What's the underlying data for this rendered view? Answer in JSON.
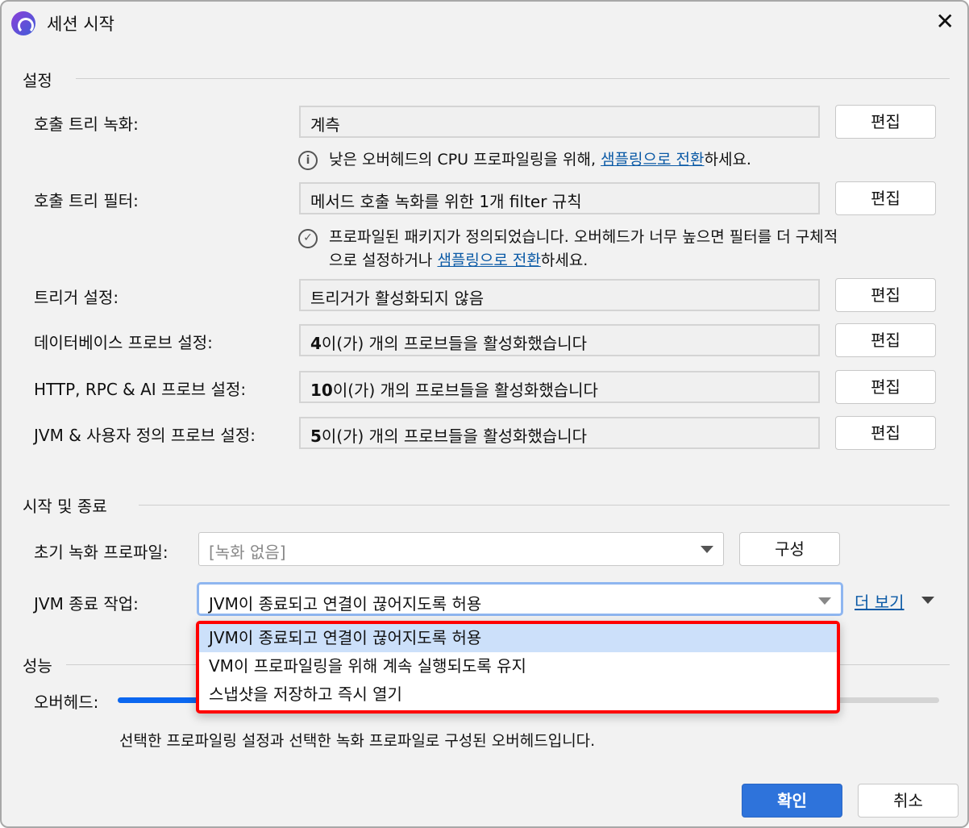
{
  "window": {
    "title": "세션 시작"
  },
  "sections": {
    "settings": "설정",
    "startstop": "시작 및 종료",
    "performance": "성능"
  },
  "rows": [
    {
      "label": "호출 트리 녹화:",
      "bold": "",
      "value": "계측",
      "button": "편집"
    },
    {
      "label": "호출 트리 필터:",
      "bold": "",
      "value": "메서드 호출 녹화를 위한 1개 filter 규칙",
      "button": "편집"
    },
    {
      "label": "트리거 설정:",
      "bold": "",
      "value": "트리거가 활성화되지 않음",
      "button": "편집"
    },
    {
      "label": "데이터베이스 프로브 설정:",
      "bold": "4",
      "value": "이(가) 개의 프로브들을 활성화했습니다",
      "button": "편집"
    },
    {
      "label": "HTTP, RPC & AI 프로브 설정:",
      "bold": "10",
      "value": "이(가) 개의 프로브들을 활성화했습니다",
      "button": "편집"
    },
    {
      "label": "JVM & 사용자 정의 프로브 설정:",
      "bold": "5",
      "value": "이(가) 개의 프로브들을 활성화했습니다",
      "button": "편집"
    }
  ],
  "notes": {
    "info_prefix": "낮은 오버헤드의 CPU 프로파일링을 위해, ",
    "info_link": "샘플링으로 전환",
    "info_suffix": "하세요.",
    "check_line1": "프로파일된 패키지가 정의되었습니다. 오버헤드가 너무 높으면 필터를 더 구체적",
    "check_prefix": "으로 설정하거나 ",
    "check_link": "샘플링으로 전환",
    "check_suffix": "하세요."
  },
  "startstop": {
    "initial_label": "초기 녹화 프로파일:",
    "initial_value": "[녹화 없음]",
    "configure": "구성",
    "exit_label": "JVM 종료 작업:",
    "exit_value": "JVM이 종료되고 연결이 끊어지도록 허용",
    "more": "더 보기",
    "options": [
      "JVM이 종료되고 연결이 끊어지도록 허용",
      "VM이 프로파일링을 위해 계속 실행되도록 유지",
      "스냅샷을 저장하고 즉시 열기"
    ]
  },
  "performance": {
    "overhead_label": "오버헤드:",
    "overhead_level": 0.3,
    "description": "선택한 프로파일링 설정과 선택한 녹화 프로파일로 구성된 오버헤드입니다."
  },
  "footer": {
    "ok": "확인",
    "cancel": "취소"
  },
  "colors": {
    "accent": "#2e73db",
    "highlight": "#cce0fa",
    "popup_border": "#ff0000"
  }
}
